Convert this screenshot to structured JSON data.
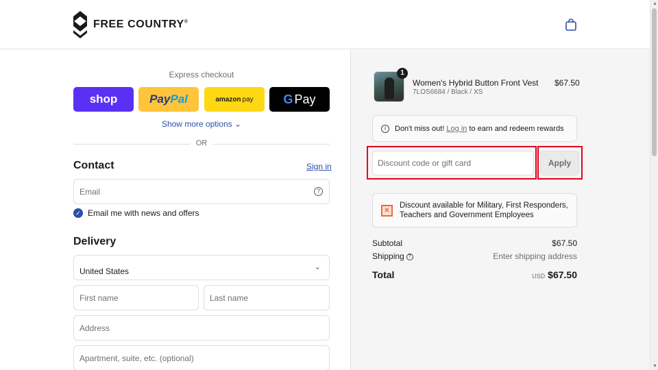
{
  "header": {
    "brand": "FREE COUNTRY",
    "trademark": "®",
    "logo_icon": "chevron-stack-logo",
    "cart_icon": "shopping-bag-icon"
  },
  "express": {
    "title": "Express checkout",
    "buttons": {
      "shop": "shop",
      "paypal_a": "Pay",
      "paypal_b": "Pal",
      "amazon_a": "amazon",
      "amazon_b": "pay",
      "gpay_g": "G",
      "gpay_text": "Pay"
    },
    "more_options": "Show more options ⌄",
    "or": "OR"
  },
  "contact": {
    "heading": "Contact",
    "sign_in": "Sign in",
    "email_placeholder": "Email",
    "newsletter_label": "Email me with news and offers",
    "newsletter_checked": true
  },
  "delivery": {
    "heading": "Delivery",
    "country_value": "United States",
    "first_name_placeholder": "First name",
    "last_name_placeholder": "Last name",
    "address_placeholder": "Address",
    "apartment_placeholder": "Apartment, suite, etc. (optional)"
  },
  "summary": {
    "item": {
      "quantity": "1",
      "name": "Women's Hybrid Button Front Vest",
      "variant": "7LOS6684 / Black / XS",
      "price": "$67.50"
    },
    "rewards": {
      "prefix": "Don't miss out!",
      "link": "Log in",
      "suffix": "to earn and redeem rewards"
    },
    "discount_placeholder": "Discount code or gift card",
    "apply_label": "Apply",
    "military_text": "Discount available for Military, First Responders, Teachers and Government Employees",
    "subtotal_label": "Subtotal",
    "subtotal_value": "$67.50",
    "shipping_label": "Shipping",
    "shipping_value": "Enter shipping address",
    "total_label": "Total",
    "total_currency": "USD",
    "total_value": "$67.50"
  },
  "colors": {
    "shop_purple": "#5a31f4",
    "paypal_yellow": "#ffc439",
    "amazon_yellow": "#ffd814",
    "link_blue": "#2c4fa8",
    "highlight_red": "#e3001b",
    "summary_bg": "#f5f5f5"
  }
}
